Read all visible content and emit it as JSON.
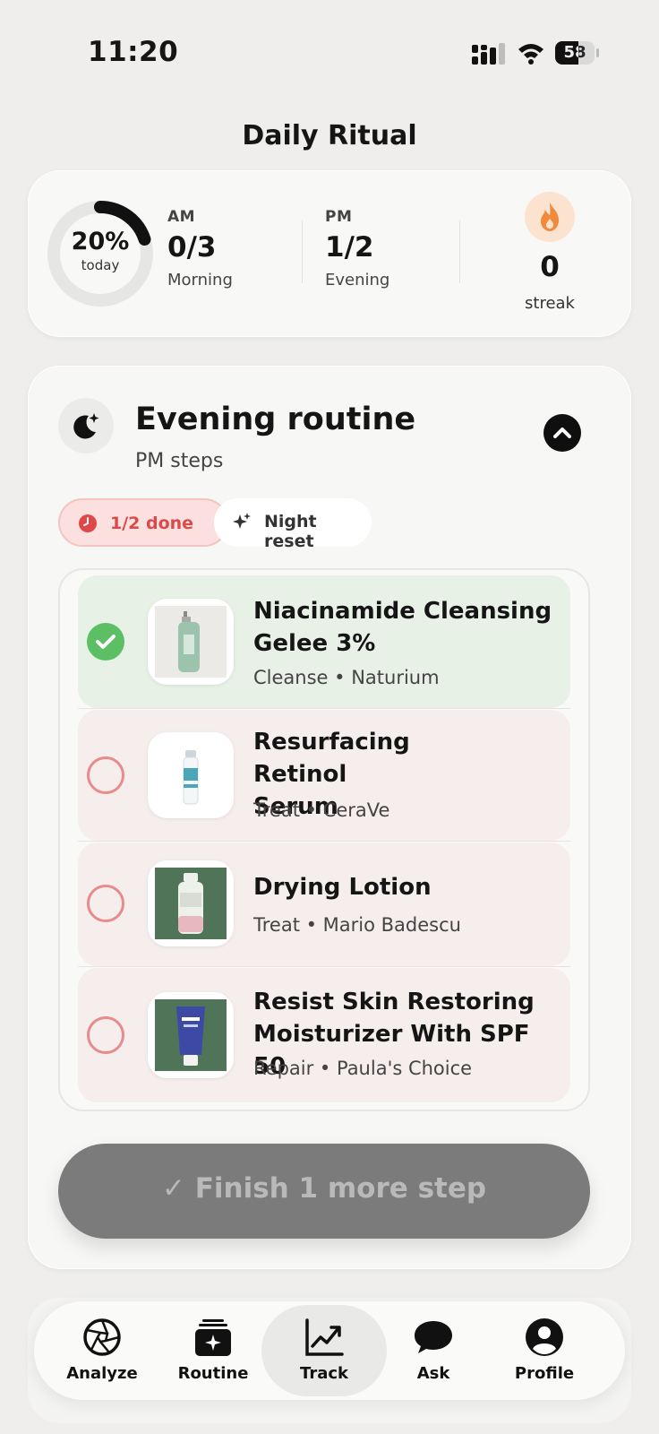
{
  "status_bar": {
    "time": "11:20",
    "battery": "58",
    "battery_level": 0.58
  },
  "page_title": "Daily Ritual",
  "summary": {
    "progress_percent": "20%",
    "progress_fraction": 0.2,
    "progress_label": "today",
    "am": {
      "key": "AM",
      "value": "0/3",
      "label": "Morning"
    },
    "pm": {
      "key": "PM",
      "value": "1/2",
      "label": "Evening"
    },
    "streak": {
      "value": "0",
      "label": "streak"
    }
  },
  "routine": {
    "title": "Evening routine",
    "subtitle": "PM steps",
    "chips": {
      "done": "1/2 done",
      "reset": "Night reset"
    },
    "items": [
      {
        "name": "Niacinamide Cleansing Gelee 3%",
        "meta": "Cleanse • Naturium",
        "checked": true
      },
      {
        "name": "Resurfacing Retinol Serum",
        "meta": "Treat • CeraVe",
        "checked": false
      },
      {
        "name": "Drying Lotion",
        "meta": "Treat • Mario Badescu",
        "checked": false
      },
      {
        "name": "Resist Skin Restoring Moisturizer With SPF 50",
        "meta": "Repair • Paula's Choice",
        "checked": false
      }
    ],
    "finish_button": "Finish 1 more step"
  },
  "nav": {
    "tabs": [
      {
        "label": "Analyze",
        "icon": "aperture-icon"
      },
      {
        "label": "Routine",
        "icon": "routine-stack-icon"
      },
      {
        "label": "Track",
        "icon": "trend-chart-icon",
        "active": true
      },
      {
        "label": "Ask",
        "icon": "chat-bubble-icon"
      },
      {
        "label": "Profile",
        "icon": "profile-icon"
      }
    ]
  },
  "colors": {
    "accent_dark": "#0f0f0f",
    "checked_green": "#5cbf64",
    "pending_red": "#e88b8b",
    "done_chip_red": "#d94b4b",
    "streak_orange": "#f08a3c"
  }
}
